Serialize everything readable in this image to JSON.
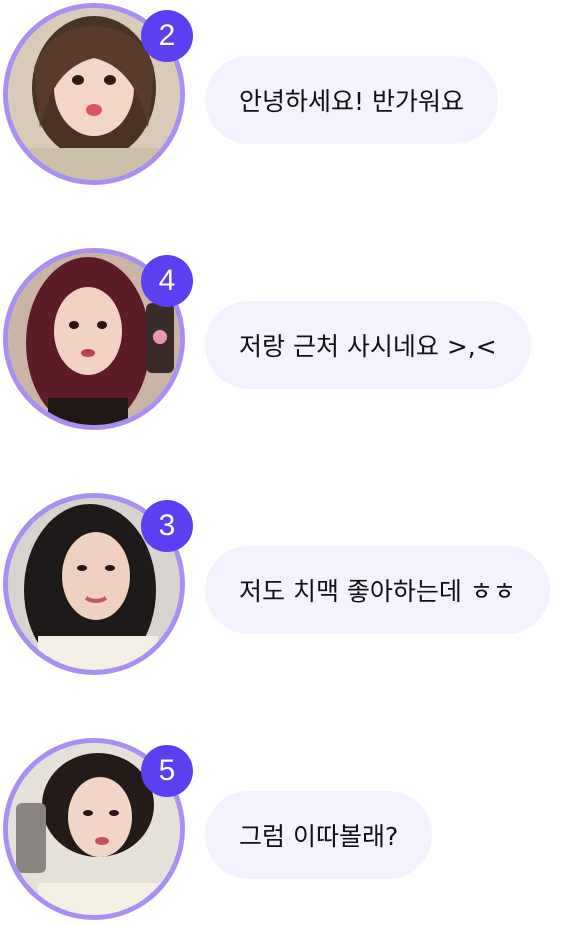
{
  "theme": {
    "ring_color": "#a98ff0",
    "badge_color": "#5b3ff0",
    "bubble_color": "#f3f2fd",
    "text_color": "#111111"
  },
  "messages": [
    {
      "unread_count": "2",
      "text": "안녕하세요! 반가워요",
      "avatar": "profile-photo"
    },
    {
      "unread_count": "4",
      "text": "저랑 근처 사시네요 >,<",
      "avatar": "profile-photo"
    },
    {
      "unread_count": "3",
      "text": "저도 치맥 좋아하는데 ㅎㅎ",
      "avatar": "profile-photo"
    },
    {
      "unread_count": "5",
      "text": "그럼 이따볼래?",
      "avatar": "profile-photo"
    }
  ]
}
